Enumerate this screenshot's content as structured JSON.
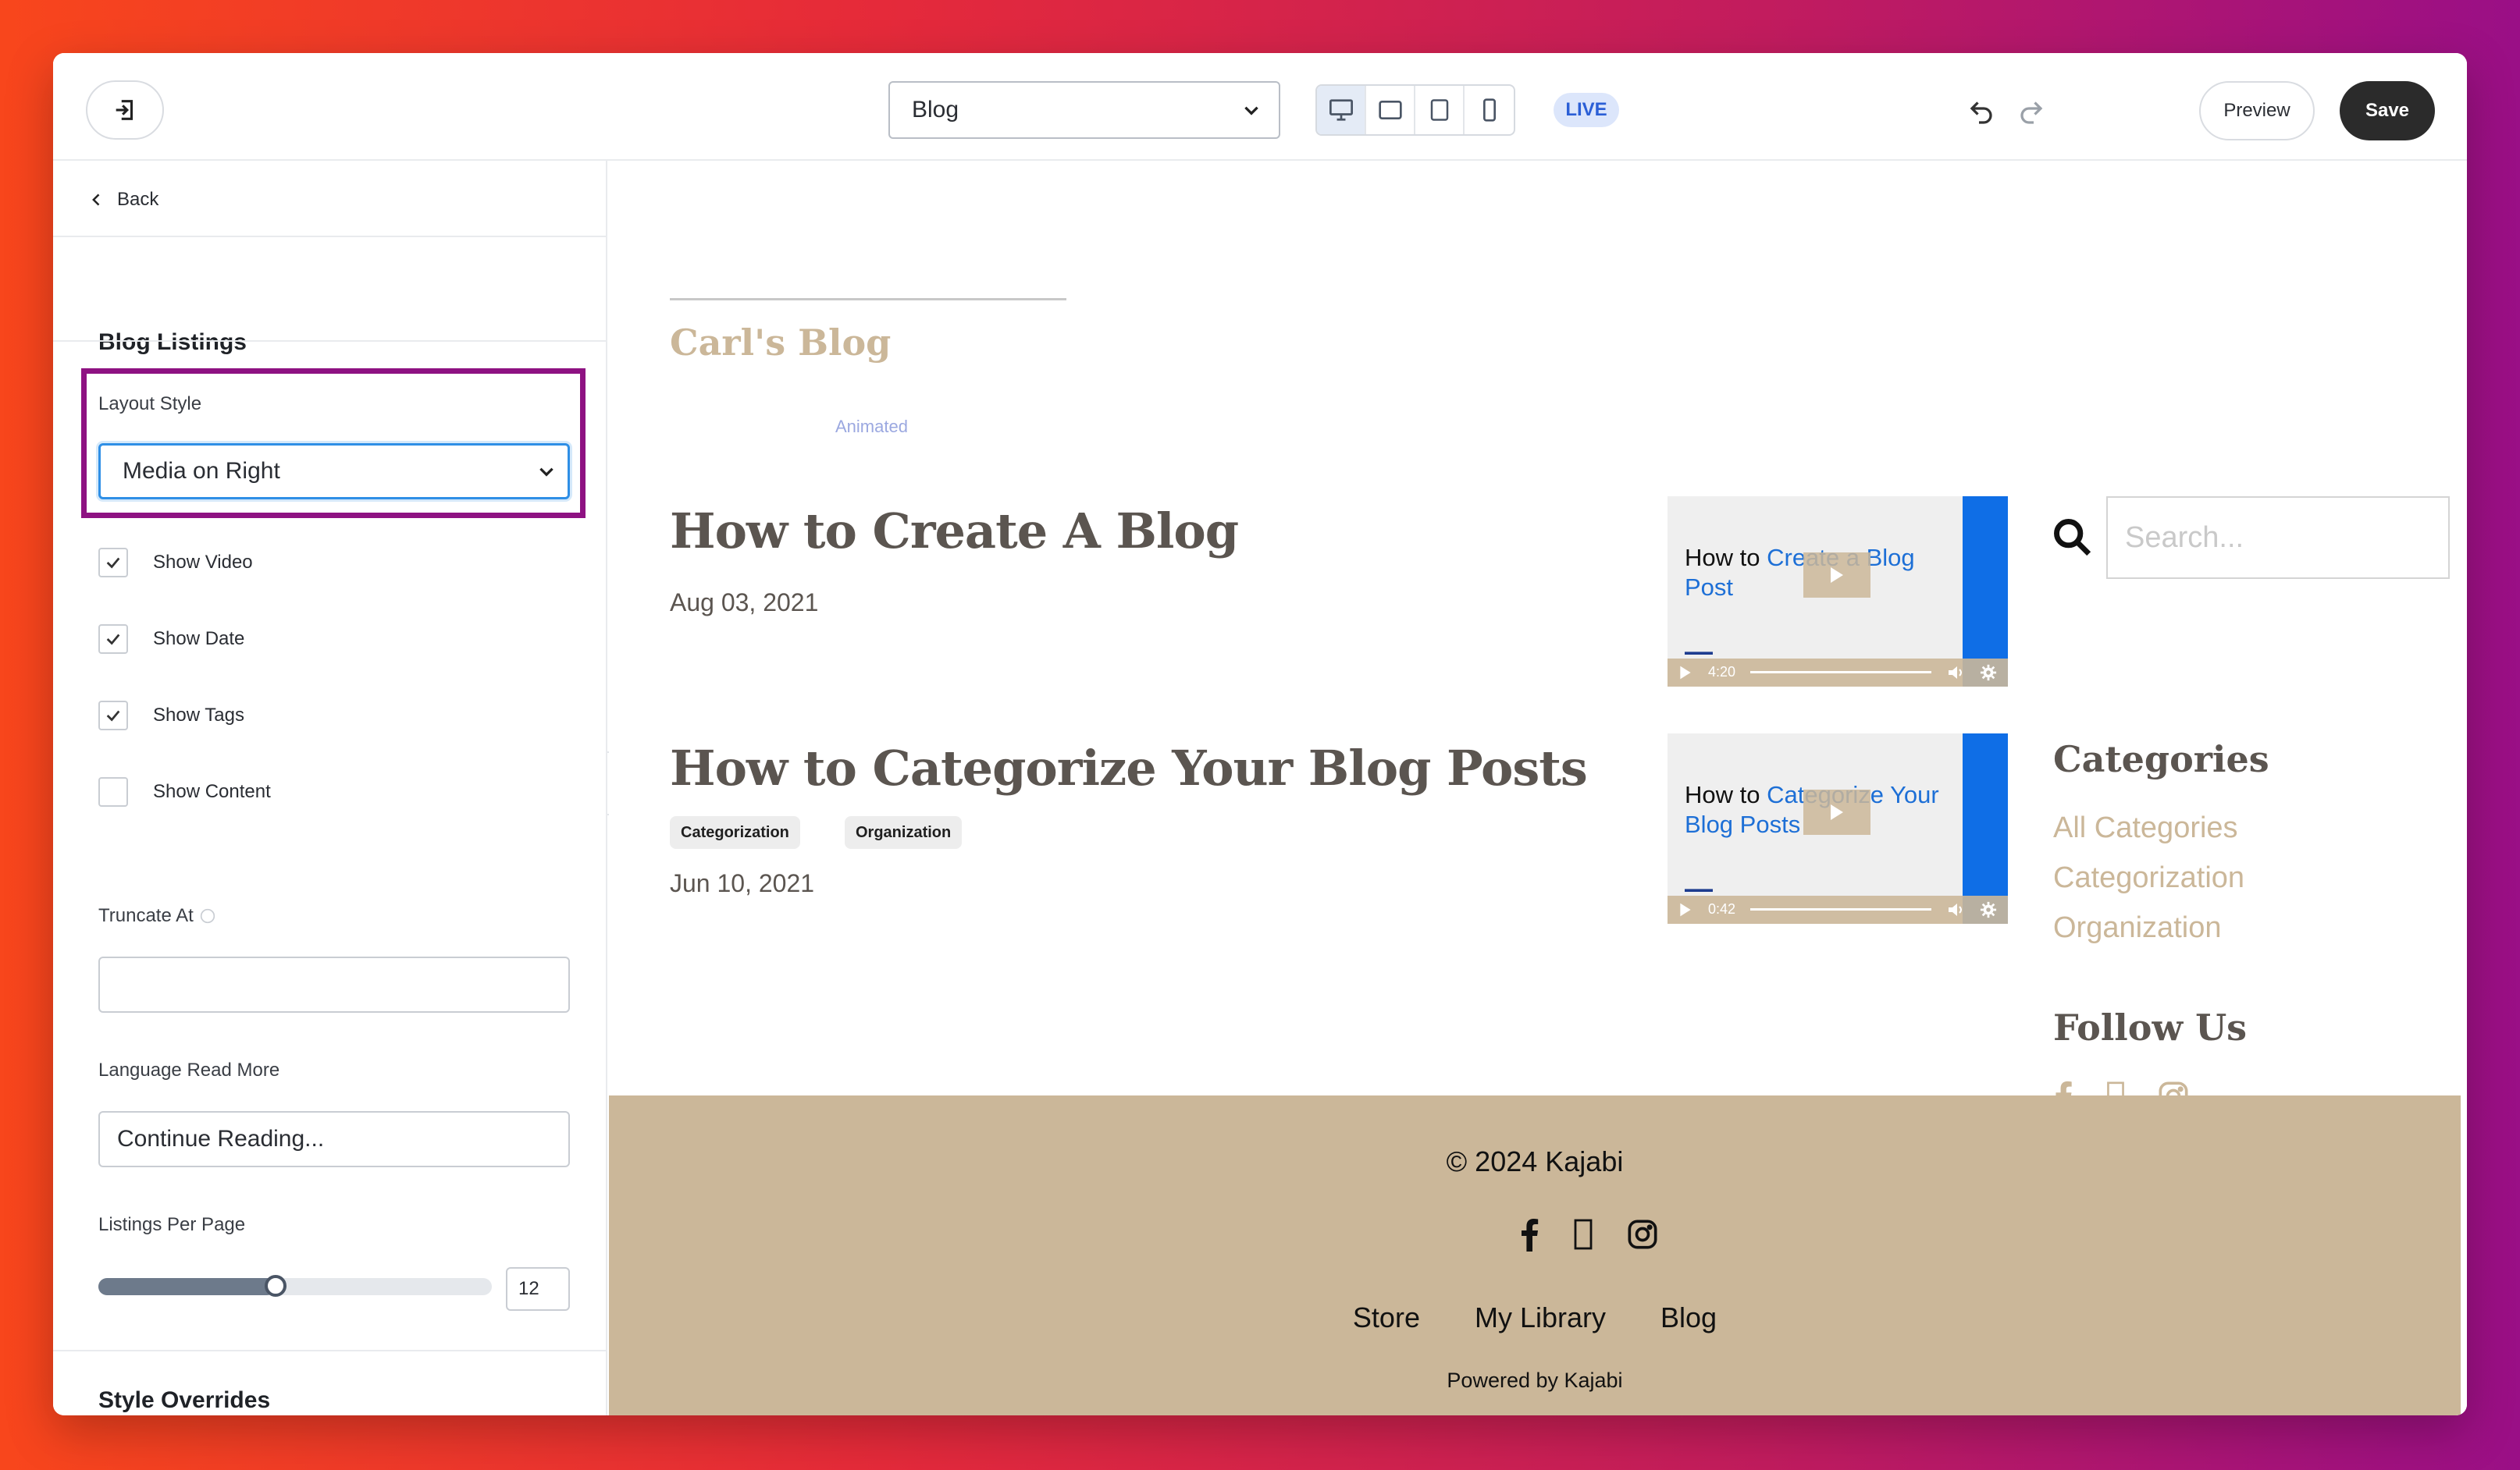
{
  "topbar": {
    "page_selected": "Blog",
    "live_badge": "LIVE",
    "preview_label": "Preview",
    "save_label": "Save"
  },
  "sidebar": {
    "back_label": "Back",
    "section_title": "Blog Listings",
    "layout_style_label": "Layout Style",
    "layout_style_value": "Media on Right",
    "checkboxes": [
      {
        "label": "Show Video",
        "checked": true
      },
      {
        "label": "Show Date",
        "checked": true
      },
      {
        "label": "Show Tags",
        "checked": true
      },
      {
        "label": "Show Content",
        "checked": false
      }
    ],
    "truncate_label": "Truncate At",
    "truncate_value": "",
    "read_more_label": "Language Read More",
    "read_more_value": "Continue Reading...",
    "listings_label": "Listings Per Page",
    "listings_value": "12",
    "listings_fraction": 0.45,
    "style_overrides_label": "Style Overrides"
  },
  "canvas": {
    "blog_title": "Carl's Blog",
    "animated_label": "Animated",
    "posts": [
      {
        "title": "How to Create A Blog",
        "date": "Aug 03, 2021",
        "tags": [],
        "video": {
          "title_black": "How to ",
          "title_blue": "Create a Blog Post",
          "duration": "4:20"
        }
      },
      {
        "title": "How to Categorize Your Blog Posts",
        "date": "Jun 10, 2021",
        "tags": [
          "Categorization",
          "Organization"
        ],
        "video": {
          "title_black": "How to ",
          "title_blue": "Categorize Your Blog Posts",
          "duration": "0:42"
        }
      }
    ],
    "search_placeholder": "Search...",
    "categories_title": "Categories",
    "categories": [
      "All Categories",
      "Categorization",
      "Organization"
    ],
    "follow_title": "Follow Us"
  },
  "footer": {
    "copyright": "© 2024 Kajabi",
    "links": [
      "Store",
      "My Library",
      "Blog"
    ],
    "powered": "Powered by Kajabi"
  },
  "colors": {
    "accent_tan": "#cbb799",
    "highlight_purple": "#8e1282",
    "live_blue": "#2b5fd6"
  }
}
